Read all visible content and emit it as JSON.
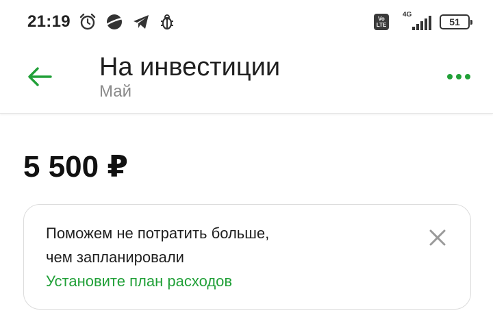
{
  "status_bar": {
    "time": "21:19",
    "icons": [
      "alarm-icon",
      "planet-icon",
      "telegram-icon",
      "bug-icon"
    ],
    "volte_line1": "Vo",
    "volte_line2": "LTE",
    "network": "4G",
    "battery": "51"
  },
  "header": {
    "title": "На инвестиции",
    "subtitle": "Май",
    "back_icon": "arrow-left-icon",
    "more_icon": "more-dots-icon",
    "accent": "#21a038"
  },
  "amount": "5 500 ₽",
  "hint_card": {
    "line1": "Поможем не потратить больше,",
    "line2": "чем запланировали",
    "link": "Установите план расходов",
    "close_icon": "close-icon"
  }
}
